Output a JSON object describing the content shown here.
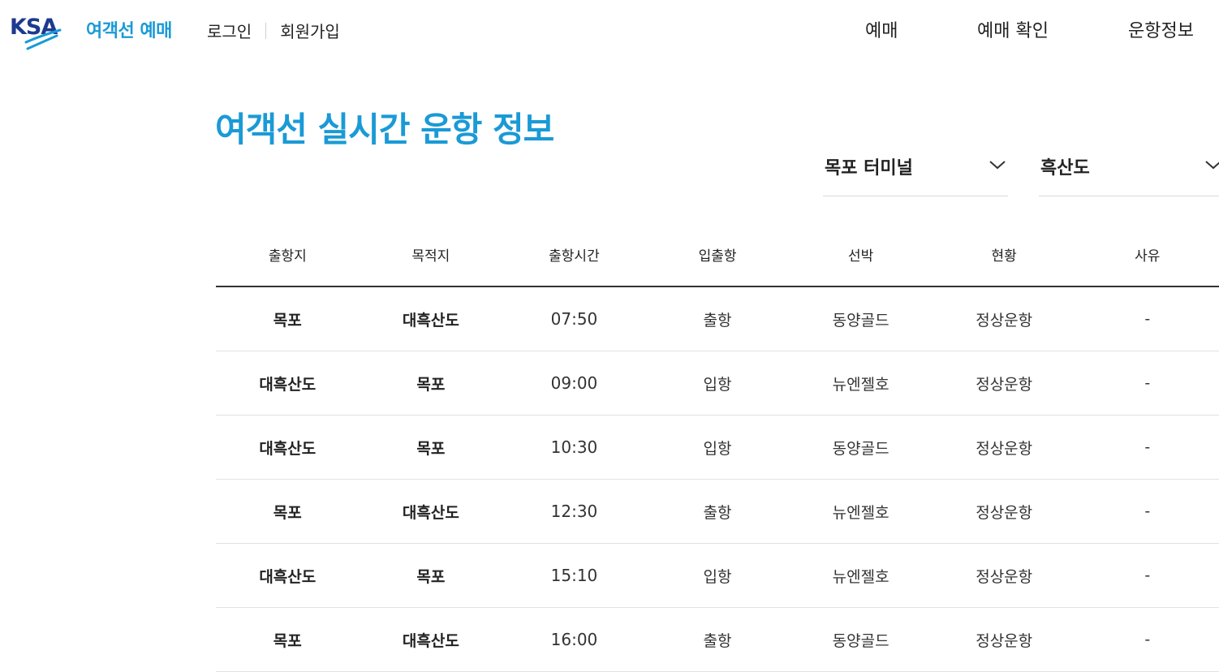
{
  "header": {
    "logo_text": "KSA",
    "brand": "여객선 예매",
    "auth": {
      "login": "로그인",
      "signup": "회원가입"
    },
    "nav": [
      {
        "label": "예매"
      },
      {
        "label": "예매 확인"
      },
      {
        "label": "운항정보"
      }
    ]
  },
  "colors": {
    "accent": "#1a9ad6",
    "logo_navy": "#1d3a8f"
  },
  "page": {
    "title": "여객선 실시간 운항 정보"
  },
  "filters": {
    "terminal": {
      "value": "목포 터미널",
      "icon": "chevron-down-icon"
    },
    "destination": {
      "value": "흑산도",
      "icon": "chevron-down-icon"
    }
  },
  "table": {
    "headers": [
      "출항지",
      "목적지",
      "출항시간",
      "입출항",
      "선박",
      "현황",
      "사유"
    ],
    "rows": [
      [
        "목포",
        "대흑산도",
        "07:50",
        "출항",
        "동양골드",
        "정상운항",
        "-"
      ],
      [
        "대흑산도",
        "목포",
        "09:00",
        "입항",
        "뉴엔젤호",
        "정상운항",
        "-"
      ],
      [
        "대흑산도",
        "목포",
        "10:30",
        "입항",
        "동양골드",
        "정상운항",
        "-"
      ],
      [
        "목포",
        "대흑산도",
        "12:30",
        "출항",
        "뉴엔젤호",
        "정상운항",
        "-"
      ],
      [
        "대흑산도",
        "목포",
        "15:10",
        "입항",
        "뉴엔젤호",
        "정상운항",
        "-"
      ],
      [
        "목포",
        "대흑산도",
        "16:00",
        "출항",
        "동양골드",
        "정상운항",
        "-"
      ]
    ]
  }
}
